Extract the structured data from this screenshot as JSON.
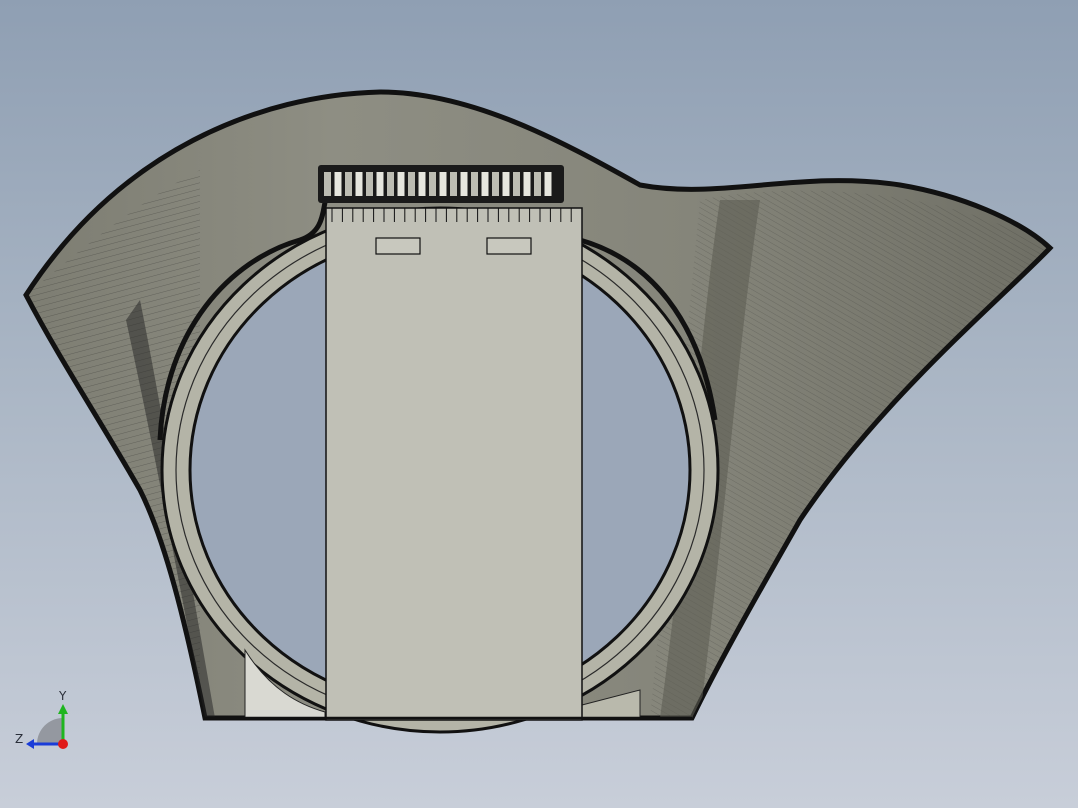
{
  "viewport": {
    "background_top": "#8f9fb3",
    "background_bottom": "#c8ced9"
  },
  "model": {
    "body_color": "#8a8a80",
    "shade_color": "#6e6e64",
    "panel_color": "#c2c2b8",
    "ring_color": "#b9b9ac",
    "edge_color": "#111111"
  },
  "triad": {
    "y_label": "Y",
    "z_label": "Z",
    "y_color": "#1fb51f",
    "z_color": "#1a3cd8",
    "x_color": "#e01919"
  }
}
